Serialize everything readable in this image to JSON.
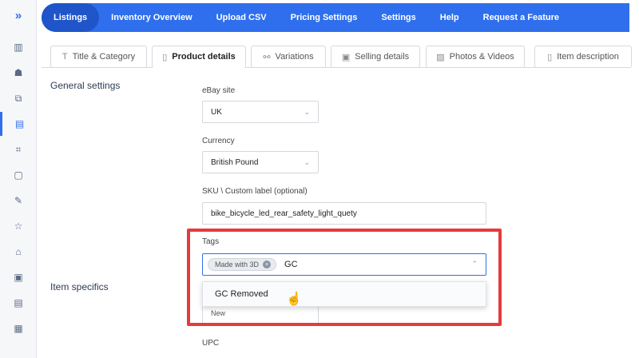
{
  "rail": {
    "items": [
      {
        "icon": "expand-icon",
        "glyph": "»"
      },
      {
        "icon": "chart-icon",
        "glyph": "▥"
      },
      {
        "icon": "user-icon",
        "glyph": "☗"
      },
      {
        "icon": "layers-icon",
        "glyph": "⧉"
      },
      {
        "icon": "listing-icon",
        "glyph": "▤"
      },
      {
        "icon": "tag-icon",
        "glyph": "⌗"
      },
      {
        "icon": "chat-icon",
        "glyph": "▢"
      },
      {
        "icon": "pen-icon",
        "glyph": "✎"
      },
      {
        "icon": "star-icon",
        "glyph": "☆"
      },
      {
        "icon": "inbox-icon",
        "glyph": "⌂"
      },
      {
        "icon": "truck-icon",
        "glyph": "▣"
      },
      {
        "icon": "document-icon",
        "glyph": "▤"
      },
      {
        "icon": "store-icon",
        "glyph": "▦"
      }
    ]
  },
  "nav": {
    "items": [
      "Listings",
      "Inventory Overview",
      "Upload CSV",
      "Pricing Settings",
      "Settings",
      "Help",
      "Request a Feature"
    ],
    "active": "Listings"
  },
  "tabs": [
    {
      "label": "Title & Category",
      "icon": "title-icon",
      "glyph": "T"
    },
    {
      "label": "Product details",
      "icon": "clipboard-icon",
      "glyph": "▯"
    },
    {
      "label": "Variations",
      "icon": "variations-icon",
      "glyph": "⚯"
    },
    {
      "label": "Selling details",
      "icon": "selling-icon",
      "glyph": "▣"
    },
    {
      "label": "Photos & Videos",
      "icon": "photo-icon",
      "glyph": "▨"
    },
    {
      "label": "Item description",
      "icon": "description-icon",
      "glyph": "▯"
    }
  ],
  "sections": {
    "general": "General settings",
    "specifics": "Item specifics"
  },
  "fields": {
    "ebay_site": {
      "label": "eBay site",
      "value": "UK"
    },
    "currency": {
      "label": "Currency",
      "value": "British Pound"
    },
    "sku": {
      "label": "SKU \\ Custom label (optional)",
      "value": "bike_bicycle_led_rear_safety_light_quety"
    },
    "tags": {
      "label": "Tags",
      "chip": "Made with 3D",
      "typed": "GC"
    },
    "condition_value": "New",
    "upc_label": "UPC"
  },
  "dropdown": {
    "option": "GC Removed"
  },
  "colors": {
    "accent": "#2f6fed",
    "highlight": "#e53b3b"
  }
}
